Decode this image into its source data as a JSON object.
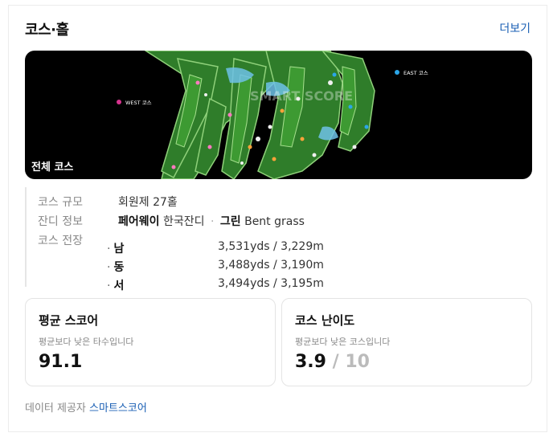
{
  "header": {
    "title": "코스·홀",
    "more_label": "더보기"
  },
  "map": {
    "overlay_label": "전체 코스",
    "pins": [
      {
        "label": "WEST 코스",
        "color": "#d6338e"
      },
      {
        "label": "EAST 코스",
        "color": "#2ba6e8"
      }
    ],
    "watermark": "SMART SCORE"
  },
  "info": {
    "size_key": "코스 규모",
    "size_value": "회원제 27홀",
    "grass_key": "잔디 정보",
    "grass_fairway_label": "페어웨이",
    "grass_fairway_value": "한국잔디",
    "grass_sep": "·",
    "grass_green_label": "그린",
    "grass_green_value": "Bent grass",
    "length_key": "코스 전장",
    "lengths": [
      {
        "bullet": "·",
        "name": "남",
        "value": "3,531yds / 3,229m"
      },
      {
        "bullet": "·",
        "name": "동",
        "value": "3,488yds / 3,190m"
      },
      {
        "bullet": "·",
        "name": "서",
        "value": "3,494yds / 3,195m"
      }
    ]
  },
  "stats": {
    "avg_score": {
      "title": "평균 스코어",
      "sub": "평균보다 낮은 타수입니다",
      "value": "91.1"
    },
    "difficulty": {
      "title": "코스 난이도",
      "sub": "평균보다 낮은 코스입니다",
      "value": "3.9",
      "max": "/ 10"
    }
  },
  "footer": {
    "provider_label": "데이터 제공자",
    "provider_name": "스마트스코어"
  }
}
